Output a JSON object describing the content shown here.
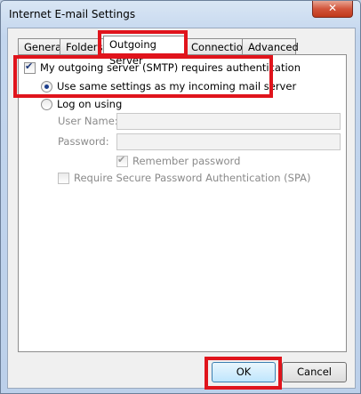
{
  "window": {
    "title": "Internet E-mail Settings",
    "close_glyph": "✕"
  },
  "tabs": [
    {
      "label": "General"
    },
    {
      "label": "Folders"
    },
    {
      "label": "Outgoing Server",
      "active": true
    },
    {
      "label": "Connection"
    },
    {
      "label": "Advanced"
    }
  ],
  "smtp": {
    "requires_auth_label": "My outgoing server (SMTP) requires authentication",
    "requires_auth_checked": true,
    "same_settings_label": "Use same settings as my incoming mail server",
    "same_settings_selected": true,
    "log_on_label": "Log on using",
    "log_on_selected": false,
    "username_label": "User Name:",
    "username_value": "",
    "password_label": "Password:",
    "password_value": "",
    "remember_label": "Remember password",
    "remember_checked": true,
    "spa_label": "Require Secure Password Authentication (SPA)",
    "spa_checked": false
  },
  "buttons": {
    "ok": "OK",
    "cancel": "Cancel"
  },
  "colors": {
    "highlight": "#e0141c",
    "accent": "#1b3d8c"
  }
}
